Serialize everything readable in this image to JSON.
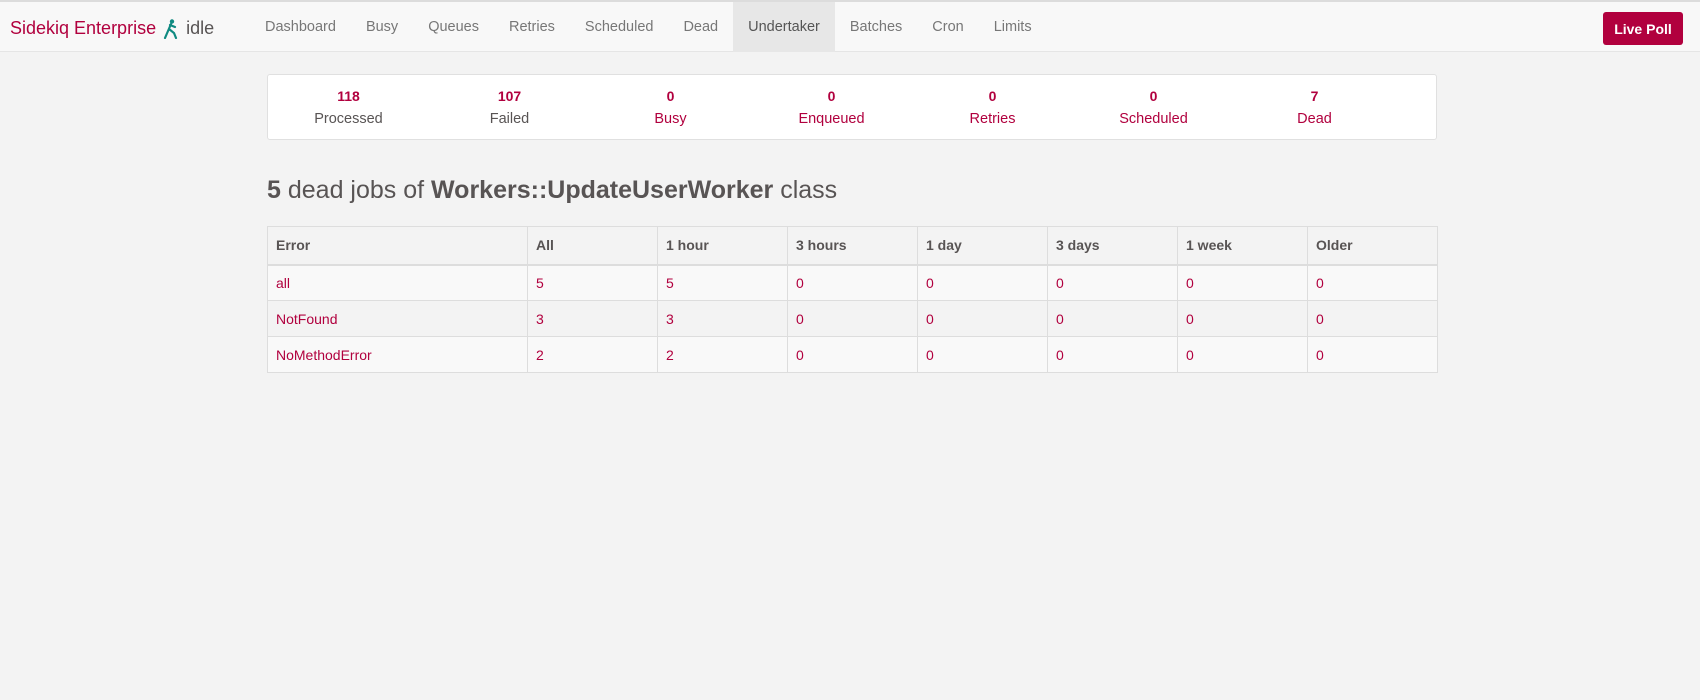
{
  "brand": {
    "name": "Sidekiq Enterprise",
    "status": "idle"
  },
  "nav": {
    "items": [
      {
        "label": "Dashboard"
      },
      {
        "label": "Busy"
      },
      {
        "label": "Queues"
      },
      {
        "label": "Retries"
      },
      {
        "label": "Scheduled"
      },
      {
        "label": "Dead"
      },
      {
        "label": "Undertaker",
        "active": true
      },
      {
        "label": "Batches"
      },
      {
        "label": "Cron"
      },
      {
        "label": "Limits"
      }
    ],
    "live_poll_label": "Live Poll"
  },
  "summary": [
    {
      "count": "118",
      "label": "Processed"
    },
    {
      "count": "107",
      "label": "Failed"
    },
    {
      "count": "0",
      "label": "Busy"
    },
    {
      "count": "0",
      "label": "Enqueued"
    },
    {
      "count": "0",
      "label": "Retries"
    },
    {
      "count": "0",
      "label": "Scheduled"
    },
    {
      "count": "7",
      "label": "Dead"
    }
  ],
  "heading": {
    "count": "5",
    "text1": " dead jobs of ",
    "worker_class": "Workers::UpdateUserWorker",
    "text2": " class"
  },
  "table": {
    "headers": [
      "Error",
      "All",
      "1 hour",
      "3 hours",
      "1 day",
      "3 days",
      "1 week",
      "Older"
    ],
    "rows": [
      [
        "all",
        "5",
        "5",
        "0",
        "0",
        "0",
        "0",
        "0"
      ],
      [
        "NotFound",
        "3",
        "3",
        "0",
        "0",
        "0",
        "0",
        "0"
      ],
      [
        "NoMethodError",
        "2",
        "2",
        "0",
        "0",
        "0",
        "0",
        "0"
      ]
    ]
  },
  "colors": {
    "accent": "#b1003e",
    "status_icon": "#0f8a81"
  },
  "icons": {
    "status": "running-figure-icon"
  }
}
